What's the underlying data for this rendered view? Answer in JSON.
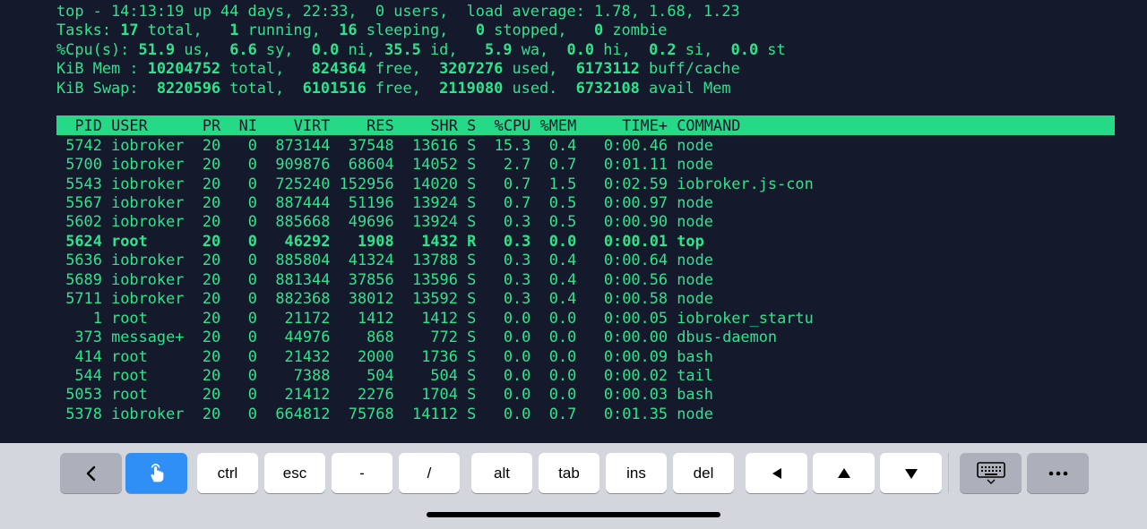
{
  "summary": {
    "line1": "top - 14:13:19 up 44 days, 22:33,  0 users,  load average: 1.78, 1.68, 1.23",
    "tasks": {
      "p1": "Tasks: ",
      "total": "17",
      "p2": " total,   ",
      "running": "1",
      "p3": " running,  ",
      "sleeping": "16",
      "p4": " sleeping,   ",
      "stopped": "0",
      "p5": " stopped,   ",
      "zombie": "0",
      "p6": " zombie"
    },
    "cpu": {
      "p1": "%Cpu(s): ",
      "us": "51.9",
      "p2": " us,  ",
      "sy": "6.6",
      "p3": " sy,  ",
      "ni": "0.0",
      "p4": " ni, ",
      "id": "35.5",
      "p5": " id,   ",
      "wa": "5.9",
      "p6": " wa,  ",
      "hi": "0.0",
      "p7": " hi,  ",
      "si": "0.2",
      "p8": " si,  ",
      "st": "0.0",
      "p9": " st"
    },
    "mem": {
      "p1": "KiB Mem : ",
      "total": "10204752",
      "p2": " total,   ",
      "free": "824364",
      "p3": " free,  ",
      "used": "3207276",
      "p4": " used,  ",
      "buff": "6173112",
      "p5": " buff/cache"
    },
    "swap": {
      "p1": "KiB Swap:  ",
      "total": "8220596",
      "p2": " total,  ",
      "free": "6101516",
      "p3": " free,  ",
      "used": "2119080",
      "p4": " used.  ",
      "avail": "6732108",
      "p5": " avail Mem"
    }
  },
  "table": {
    "headers": [
      "PID",
      "USER",
      "PR",
      "NI",
      "VIRT",
      "RES",
      "SHR",
      "S",
      "%CPU",
      "%MEM",
      "TIME+",
      "COMMAND"
    ],
    "rows": [
      [
        "5742",
        "iobroker",
        "20",
        "0",
        "873144",
        "37548",
        "13616",
        "S",
        "15.3",
        "0.4",
        "0:00.46",
        "node"
      ],
      [
        "5700",
        "iobroker",
        "20",
        "0",
        "909876",
        "68604",
        "14052",
        "S",
        "2.7",
        "0.7",
        "0:01.11",
        "node"
      ],
      [
        "5543",
        "iobroker",
        "20",
        "0",
        "725240",
        "152956",
        "14020",
        "S",
        "0.7",
        "1.5",
        "0:02.59",
        "iobroker.js-con"
      ],
      [
        "5567",
        "iobroker",
        "20",
        "0",
        "887444",
        "51196",
        "13924",
        "S",
        "0.7",
        "0.5",
        "0:00.97",
        "node"
      ],
      [
        "5602",
        "iobroker",
        "20",
        "0",
        "885668",
        "49696",
        "13924",
        "S",
        "0.3",
        "0.5",
        "0:00.90",
        "node"
      ],
      [
        "5624",
        "root",
        "20",
        "0",
        "46292",
        "1908",
        "1432",
        "R",
        "0.3",
        "0.0",
        "0:00.01",
        "top"
      ],
      [
        "5636",
        "iobroker",
        "20",
        "0",
        "885804",
        "41324",
        "13788",
        "S",
        "0.3",
        "0.4",
        "0:00.64",
        "node"
      ],
      [
        "5689",
        "iobroker",
        "20",
        "0",
        "881344",
        "37856",
        "13596",
        "S",
        "0.3",
        "0.4",
        "0:00.56",
        "node"
      ],
      [
        "5711",
        "iobroker",
        "20",
        "0",
        "882368",
        "38012",
        "13592",
        "S",
        "0.3",
        "0.4",
        "0:00.58",
        "node"
      ],
      [
        "1",
        "root",
        "20",
        "0",
        "21172",
        "1412",
        "1412",
        "S",
        "0.0",
        "0.0",
        "0:00.05",
        "iobroker_startu"
      ],
      [
        "373",
        "message+",
        "20",
        "0",
        "44976",
        "868",
        "772",
        "S",
        "0.0",
        "0.0",
        "0:00.00",
        "dbus-daemon"
      ],
      [
        "414",
        "root",
        "20",
        "0",
        "21432",
        "2000",
        "1736",
        "S",
        "0.0",
        "0.0",
        "0:00.09",
        "bash"
      ],
      [
        "544",
        "root",
        "20",
        "0",
        "7388",
        "504",
        "504",
        "S",
        "0.0",
        "0.0",
        "0:00.02",
        "tail"
      ],
      [
        "5053",
        "root",
        "20",
        "0",
        "21412",
        "2276",
        "1704",
        "S",
        "0.0",
        "0.0",
        "0:00.03",
        "bash"
      ],
      [
        "5378",
        "iobroker",
        "20",
        "0",
        "664812",
        "75768",
        "14112",
        "S",
        "0.0",
        "0.7",
        "0:01.35",
        "node"
      ]
    ],
    "bold_row_index": 5
  },
  "keyboard": {
    "keys": [
      {
        "label": "",
        "icon": "chevron-left-icon"
      },
      {
        "label": "",
        "icon": "touch-hand-icon"
      },
      {
        "label": "ctrl"
      },
      {
        "label": "esc"
      },
      {
        "label": "-"
      },
      {
        "label": "/"
      },
      {
        "label": "alt"
      },
      {
        "label": "tab"
      },
      {
        "label": "ins"
      },
      {
        "label": "del"
      },
      {
        "label": "",
        "icon": "left-triangle-icon"
      },
      {
        "label": "",
        "icon": "up-triangle-icon"
      },
      {
        "label": "",
        "icon": "down-triangle-icon"
      },
      {
        "label": "",
        "icon": "keyboard-dismiss-icon"
      },
      {
        "label": "",
        "icon": "more-icon"
      }
    ]
  },
  "colors": {
    "terminal_bg": "#141a2c",
    "terminal_fg": "#2fe38c",
    "header_bg": "#25d986",
    "toolbar_bg": "#d3d6dd",
    "accent_key": "#2f8ff5"
  }
}
